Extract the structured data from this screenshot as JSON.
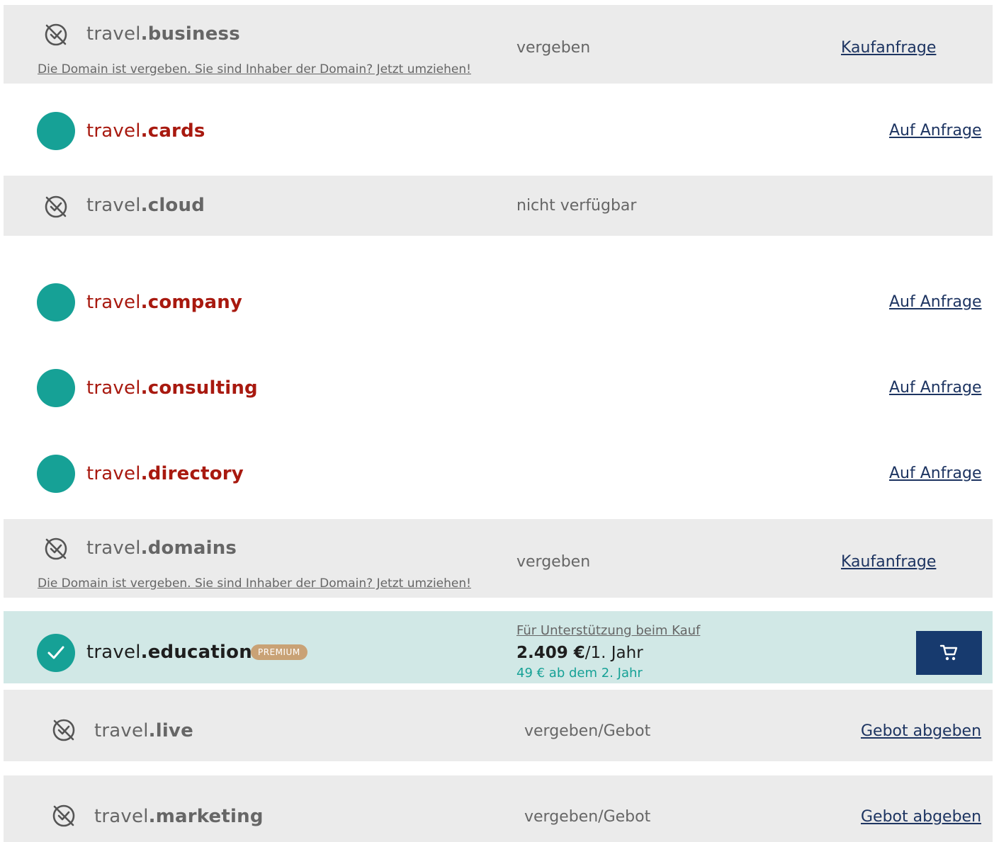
{
  "rows": [
    {
      "sld": "travel",
      "tld": ".business",
      "status": "vergeben",
      "action": "Kaufanfrage",
      "note": "Die Domain ist vergeben. Sie sind Inhaber der Domain? Jetzt umziehen!"
    },
    {
      "sld": "travel",
      "tld": ".cards",
      "action": "Auf Anfrage"
    },
    {
      "sld": "travel",
      "tld": ".cloud",
      "status": "nicht verfügbar"
    },
    {
      "sld": "travel",
      "tld": ".company",
      "action": "Auf Anfrage"
    },
    {
      "sld": "travel",
      "tld": ".consulting",
      "action": "Auf Anfrage"
    },
    {
      "sld": "travel",
      "tld": ".directory",
      "action": "Auf Anfrage"
    },
    {
      "sld": "travel",
      "tld": ".domains",
      "status": "vergeben",
      "action": "Kaufanfrage",
      "note": "Die Domain ist vergeben. Sie sind Inhaber der Domain? Jetzt umziehen!"
    },
    {
      "sld": "travel",
      "tld": ".education",
      "badge": "PREMIUM",
      "support": "Für Unterstützung beim Kauf",
      "price": "2.409 €",
      "price_period": "/1. Jahr",
      "renewal": "49 € ab dem 2. Jahr",
      "action_icon": "cart-icon"
    },
    {
      "sld": "travel",
      "tld": ".live",
      "status": "vergeben/Gebot",
      "action": "Gebot abgeben"
    },
    {
      "sld": "travel",
      "tld": ".marketing",
      "status": "vergeben/Gebot",
      "action": "Gebot abgeben"
    }
  ],
  "colors": {
    "accent_teal": "#16a196",
    "available_red": "#a8190f",
    "link_navy": "#1d3461",
    "cart_button": "#173a6e",
    "premium_badge": "#c9a276",
    "row_gray": "#ebebeb",
    "row_highlight": "#d1e8e6"
  }
}
